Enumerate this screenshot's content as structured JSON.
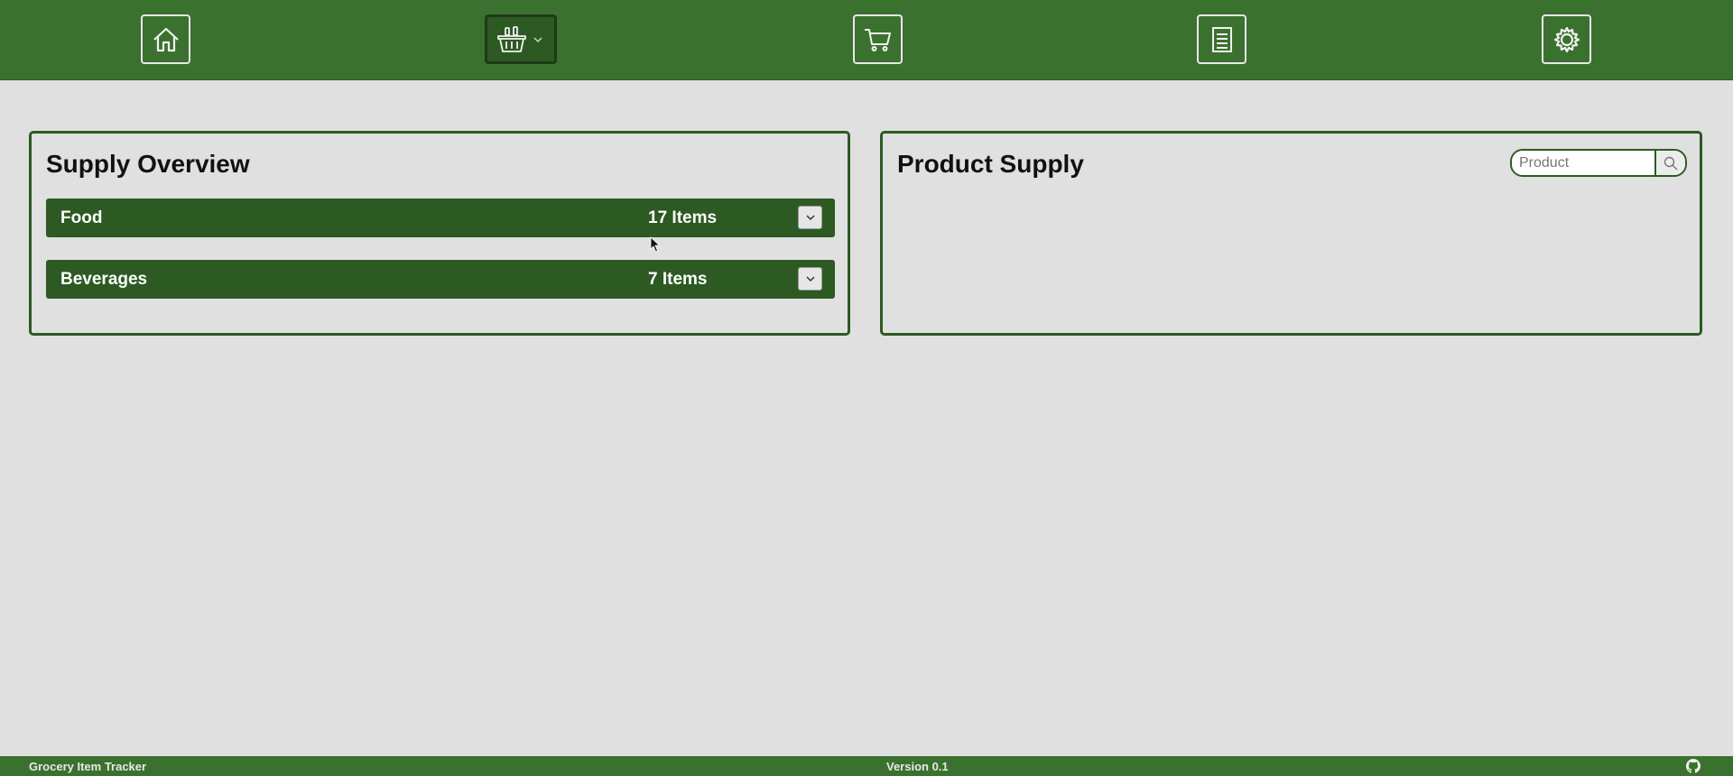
{
  "nav": {
    "items": [
      {
        "icon": "home-icon"
      },
      {
        "icon": "basket-icon",
        "active": true,
        "has_dropdown": true
      },
      {
        "icon": "cart-icon"
      },
      {
        "icon": "list-icon"
      },
      {
        "icon": "gear-icon"
      }
    ]
  },
  "overview": {
    "title": "Supply Overview",
    "categories": [
      {
        "name": "Food",
        "count": "17 Items"
      },
      {
        "name": "Beverages",
        "count": "7 Items"
      }
    ]
  },
  "product_supply": {
    "title": "Product Supply",
    "search": {
      "placeholder": "Product",
      "value": ""
    }
  },
  "footer": {
    "app_name": "Grocery Item Tracker",
    "version": "Version 0.1",
    "link_icon": "github-icon"
  },
  "colors": {
    "brand_green": "#3b712e",
    "dark_green": "#2d5a23",
    "background": "#e0e0e0"
  }
}
